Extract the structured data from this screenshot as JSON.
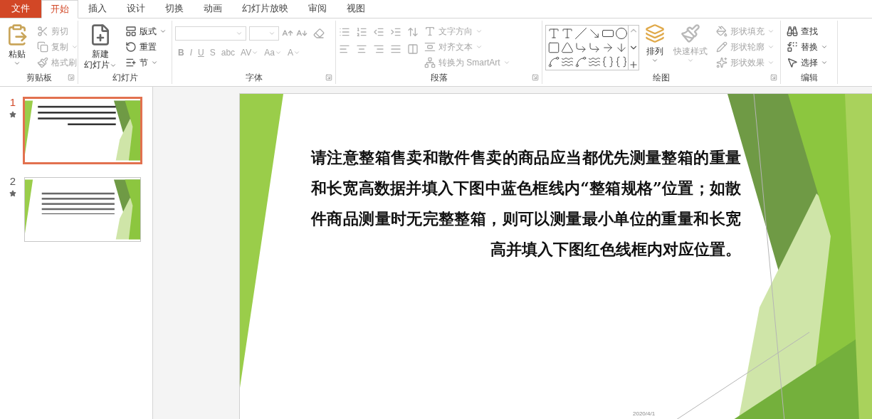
{
  "tabs": [
    {
      "label": "文件",
      "kind": "file",
      "selected": false
    },
    {
      "label": "开始",
      "kind": "tab",
      "selected": true
    },
    {
      "label": "插入",
      "kind": "tab",
      "selected": false
    },
    {
      "label": "设计",
      "kind": "tab",
      "selected": false
    },
    {
      "label": "切换",
      "kind": "tab",
      "selected": false
    },
    {
      "label": "动画",
      "kind": "tab",
      "selected": false
    },
    {
      "label": "幻灯片放映",
      "kind": "tab",
      "selected": false
    },
    {
      "label": "审阅",
      "kind": "tab",
      "selected": false
    },
    {
      "label": "视图",
      "kind": "tab",
      "selected": false
    }
  ],
  "ribbon": {
    "groups": [
      {
        "kind": "clipboard",
        "label": "剪贴板",
        "big": {
          "label": "粘贴",
          "disabled": false
        },
        "items": [
          {
            "label": "剪切",
            "disabled": true
          },
          {
            "label": "复制",
            "disabled": true,
            "dropdown": true
          },
          {
            "label": "格式刷",
            "disabled": true
          }
        ]
      },
      {
        "kind": "slides",
        "label": "幻灯片",
        "big": {
          "label": "新建",
          "label_2": "幻灯片",
          "disabled": false
        },
        "items": [
          {
            "label": "版式",
            "disabled": false,
            "dropdown": true
          },
          {
            "label": "重置",
            "disabled": false
          },
          {
            "label": "节",
            "disabled": false,
            "dropdown": true
          }
        ]
      },
      {
        "kind": "font",
        "label": "字体",
        "items": [
          {
            "label": "B",
            "disabled": true
          },
          {
            "label": "I",
            "disabled": true
          },
          {
            "label": "U",
            "disabled": true
          },
          {
            "label": "S",
            "disabled": true
          },
          {
            "label": "abc",
            "disabled": true
          },
          {
            "label": "AV",
            "disabled": true,
            "dropdown": true
          },
          {
            "label": "Aa",
            "disabled": true,
            "dropdown": true
          },
          {
            "label": "A",
            "disabled": true,
            "dropdown": true
          }
        ]
      },
      {
        "kind": "paragraph",
        "label": "段落",
        "items": [
          {
            "label": "文字方向",
            "disabled": true,
            "dropdown": true
          },
          {
            "label": "对齐文本",
            "disabled": true,
            "dropdown": true
          },
          {
            "label": "转换为 SmartArt",
            "disabled": true,
            "dropdown": true
          }
        ]
      },
      {
        "kind": "drawing",
        "label": "绘图",
        "big": {
          "label": "排列",
          "disabled": false
        },
        "big_2": {
          "label": "快速样式",
          "disabled": true
        },
        "items": [
          {
            "label": "形状填充",
            "disabled": true,
            "dropdown": true
          },
          {
            "label": "形状轮廓",
            "disabled": true,
            "dropdown": true
          },
          {
            "label": "形状效果",
            "disabled": true,
            "dropdown": true
          }
        ]
      },
      {
        "kind": "editing",
        "label": "编辑",
        "items": [
          {
            "label": "查找",
            "disabled": false
          },
          {
            "label": "替换",
            "disabled": false,
            "dropdown": true
          },
          {
            "label": "选择",
            "disabled": false,
            "dropdown": true
          }
        ]
      }
    ]
  },
  "slides_panel": {
    "slides": [
      {
        "number": "1",
        "kind": "text",
        "selected": true
      },
      {
        "number": "2",
        "kind": "scattered",
        "selected": false
      }
    ]
  },
  "slide": {
    "text": "请注意整箱售卖和散件售卖的商品应当都优先测量整箱的重量和长宽高数据并填入下图中蓝色框线内“整箱规格”位置；如散件商品测量时无完整整箱，则可以测量最小单位的重量和长宽高并填入下图红色线框内对应位置。",
    "date": "2020/4/1"
  }
}
